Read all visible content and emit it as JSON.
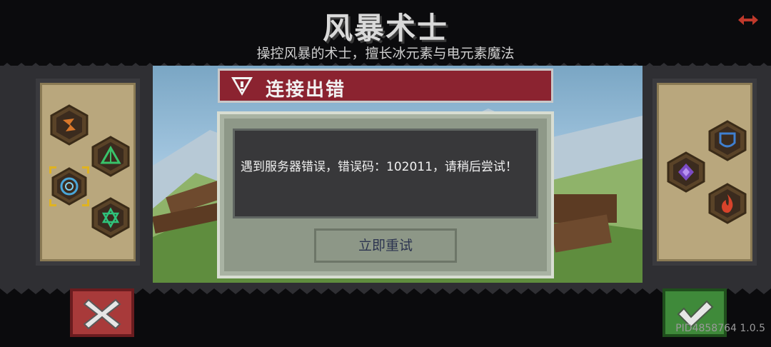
{
  "header": {
    "title": "风暴术士",
    "subtitle": "操控风暴的术士，擅长冰元素与电元素魔法",
    "back_icon": "back-arrows-icon"
  },
  "left_skills": {
    "icons": [
      "fire-swirl-skill-icon",
      "green-triangle-skill-icon",
      "blue-vortex-skill-icon",
      "green-hexagram-skill-icon"
    ],
    "selected": "blue-vortex-skill-icon"
  },
  "right_skills": {
    "icons": [
      "blue-shield-skill-icon",
      "purple-rune-skill-icon",
      "red-flame-skill-icon"
    ]
  },
  "dialog": {
    "title": "连接出错",
    "message": "遇到服务器错误，错误码：102011，请稍后尝试！",
    "retry_label": "立即重试",
    "header_color": "#8b2330"
  },
  "buttons": {
    "cancel_icon": "cross-icon",
    "confirm_icon": "checkmark-icon"
  },
  "footer": {
    "version": "PID4858764 1.0.5"
  }
}
